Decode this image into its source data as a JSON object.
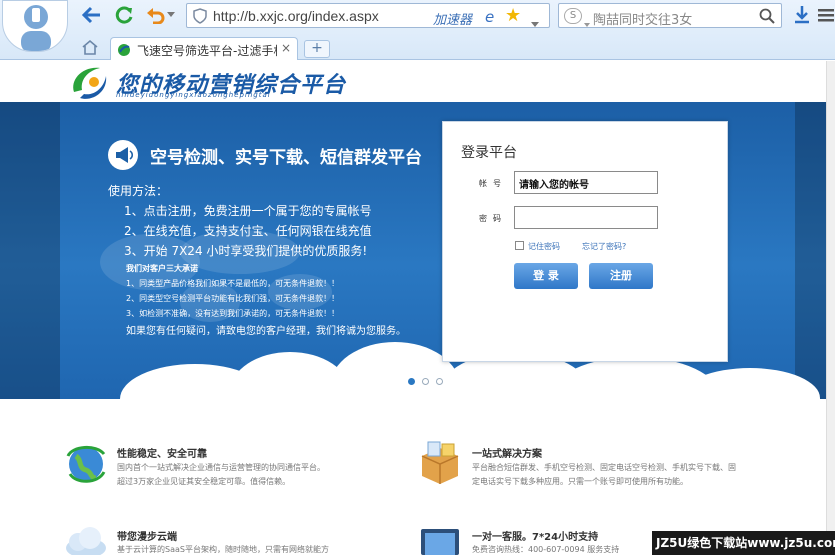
{
  "browser": {
    "url": "http://b.xxjc.org/index.aspx",
    "accelerator": "加速器",
    "search_placeholder": "陶喆同时交往3女",
    "tab_title": "飞速空号筛选平台-过滤手机空号",
    "tab_close": "×",
    "new_tab": "+"
  },
  "site": {
    "logo_text": "您的移动营销综合平台",
    "logo_sub": "nindeyidongyingxiaozonghepingtai"
  },
  "banner": {
    "headline": "空号检测、实号下载、短信群发平台",
    "usage_title": "使用方法：",
    "steps": [
      "1、点击注册，免费注册一个属于您的专属帐号",
      "2、在线充值，支持支付宝、任何网银在线充值",
      "3、开始 7X24 小时享受我们提供的优质服务!"
    ],
    "promise_title": "我们对客户三大承诺",
    "promises": [
      "1、同类型产品价格我们如果不是最低的，可无条件退款！！",
      "2、同类型空号检测平台功能有比我们强，可无条件退款！！",
      "3、如检测不准确，没有达到我们承诺的，可无条件退款！！"
    ],
    "contact": "如果您有任何疑问，请致电您的客户经理，我们将诚为您服务。"
  },
  "login": {
    "title": "登录平台",
    "account_label": "帐号",
    "account_value": "请输入您的帐号",
    "password_label": "密码",
    "remember": "记住密码",
    "forgot": "忘记了密码?",
    "login_button": "登 录",
    "register_button": "注册"
  },
  "features": [
    {
      "title": "性能稳定、安全可靠",
      "desc": [
        "国内首个一站式解决企业通信与运营管理的协同通信平台。",
        "超过3万家企业见证其安全稳定可靠。值得信赖。"
      ]
    },
    {
      "title": "一站式解决方案",
      "desc": [
        "平台融合短信群发、手机空号检测、固定电话空号检测、手机实号下载、固",
        "定电话实号下载多种应用。只需一个账号即可使用所有功能。"
      ]
    },
    {
      "title": "带您漫步云端",
      "desc": [
        "基于云计算的SaaS平台架构，随时随地，只需有网络就能方"
      ]
    },
    {
      "title": "一对一客服。7*24小时支持",
      "desc": [
        "免费咨询热线：400-607-0094 服务支持"
      ]
    }
  ],
  "watermark": "JZ5U绿色下载站www.jz5u.com",
  "colors": {
    "banner": "#2a78c2",
    "brand": "#1a5aa6",
    "button": "#2f77c8"
  }
}
